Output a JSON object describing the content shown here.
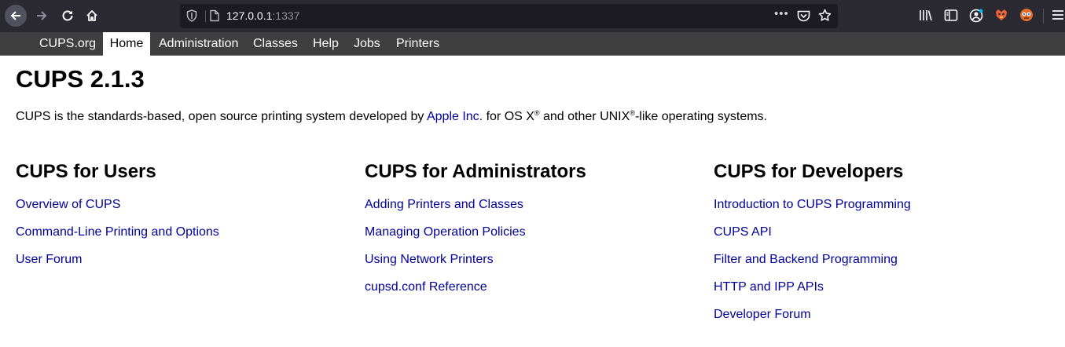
{
  "browser": {
    "url_host": "127.0.0.1",
    "url_port": ":1337",
    "icons": [
      "back-arrow-icon",
      "forward-arrow-icon",
      "reload-icon",
      "home-icon",
      "tracking-shield-icon",
      "page-icon",
      "more-dots-icon",
      "pocket-icon",
      "bookmark-star-icon",
      "library-icon",
      "sidebar-icon",
      "account-icon",
      "extension-icon",
      "extension-icon",
      "hamburger-menu-icon"
    ],
    "more_dots": "•••"
  },
  "nav": {
    "items": [
      "CUPS.org",
      "Home",
      "Administration",
      "Classes",
      "Help",
      "Jobs",
      "Printers"
    ],
    "active": "Home"
  },
  "page": {
    "title": "CUPS 2.1.3",
    "intro": {
      "before": "CUPS is the standards-based, open source printing system developed by ",
      "apple_link": "Apple Inc.",
      "mid": " for OS X",
      "reg1": "®",
      "mid2": " and other UNIX",
      "reg2": "®",
      "after": "-like operating systems."
    }
  },
  "sections": [
    {
      "title": "CUPS for Users",
      "links": [
        "Overview of CUPS",
        "Command-Line Printing and Options",
        "User Forum"
      ]
    },
    {
      "title": "CUPS for Administrators",
      "links": [
        "Adding Printers and Classes",
        "Managing Operation Policies",
        "Using Network Printers",
        "cupsd.conf Reference"
      ]
    },
    {
      "title": "CUPS for Developers",
      "links": [
        "Introduction to CUPS Programming",
        "CUPS API",
        "Filter and Backend Programming",
        "HTTP and IPP APIs",
        "Developer Forum"
      ]
    }
  ],
  "colors": {
    "toolbar_bg": "#2b2a33",
    "urlbar_bg": "#1c1b22",
    "navbar_bg": "#3f3f3f",
    "link": "#000099"
  }
}
